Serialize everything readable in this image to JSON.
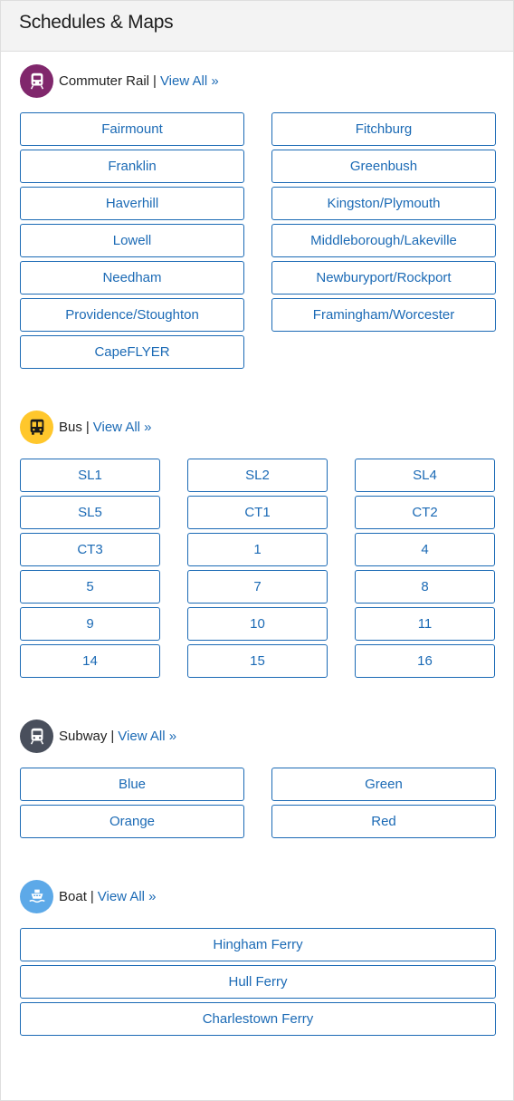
{
  "header": {
    "title": "Schedules & Maps"
  },
  "separator": "|",
  "sections": {
    "commuter_rail": {
      "label": "Commuter Rail",
      "view_all": "View All »",
      "icon": "commuter-rail-icon",
      "icon_color": "#80276c",
      "routes": [
        "Fairmount",
        "Fitchburg",
        "Franklin",
        "Greenbush",
        "Haverhill",
        "Kingston/Plymouth",
        "Lowell",
        "Middleborough/Lakeville",
        "Needham",
        "Newburyport/Rockport",
        "Providence/Stoughton",
        "Framingham/Worcester",
        "CapeFLYER"
      ]
    },
    "bus": {
      "label": "Bus",
      "view_all": "View All »",
      "icon": "bus-icon",
      "icon_color": "#ffc72c",
      "routes": [
        "SL1",
        "SL2",
        "SL4",
        "SL5",
        "CT1",
        "CT2",
        "CT3",
        "1",
        "4",
        "5",
        "7",
        "8",
        "9",
        "10",
        "11",
        "14",
        "15",
        "16"
      ]
    },
    "subway": {
      "label": "Subway",
      "view_all": "View All »",
      "icon": "subway-icon",
      "icon_color": "#494f5c",
      "routes": [
        "Blue",
        "Green",
        "Orange",
        "Red"
      ]
    },
    "boat": {
      "label": "Boat",
      "view_all": "View All »",
      "icon": "ferry-icon",
      "icon_color": "#5da9e8",
      "routes": [
        "Hingham Ferry",
        "Hull Ferry",
        "Charlestown Ferry"
      ]
    }
  },
  "colors": {
    "link": "#1b6ab5",
    "header_bg": "#f3f3f3",
    "border": "#dedede"
  }
}
